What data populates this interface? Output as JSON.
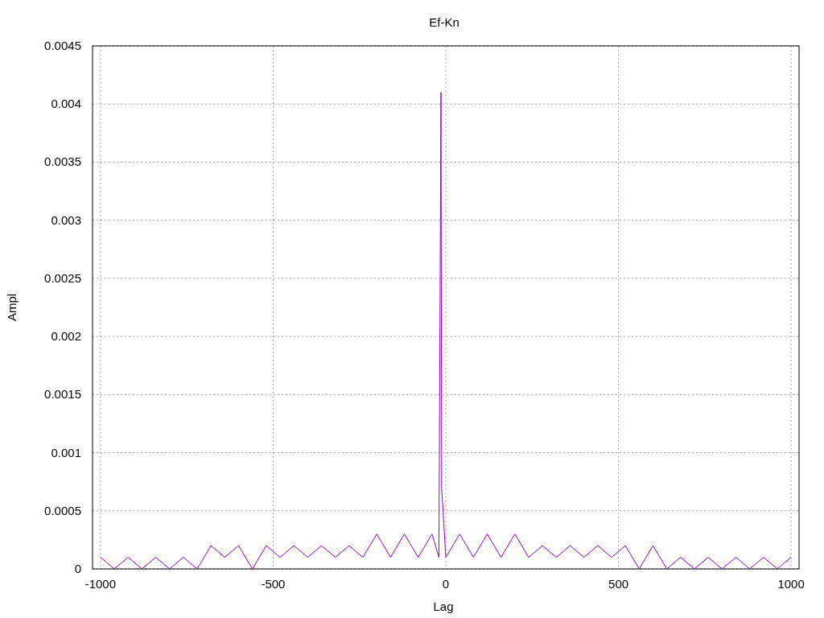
{
  "chart_data": {
    "type": "line",
    "title": "Ef-Kn",
    "xlabel": "Lag",
    "ylabel": "Ampl",
    "grid": true,
    "xlim": [
      -1023,
      1023
    ],
    "ylim": [
      0,
      0.0045
    ],
    "xticks": [
      {
        "value": -1000,
        "label": "-1000"
      },
      {
        "value": -500,
        "label": "-500"
      },
      {
        "value": 0,
        "label": "0"
      },
      {
        "value": 500,
        "label": "500"
      },
      {
        "value": 1000,
        "label": "1000"
      }
    ],
    "yticks": [
      {
        "value": 0,
        "label": "0"
      },
      {
        "value": 0.0005,
        "label": "0.0005"
      },
      {
        "value": 0.001,
        "label": "0.001"
      },
      {
        "value": 0.0015,
        "label": "0.0015"
      },
      {
        "value": 0.002,
        "label": "0.002"
      },
      {
        "value": 0.0025,
        "label": "0.0025"
      },
      {
        "value": 0.003,
        "label": "0.003"
      },
      {
        "value": 0.0035,
        "label": "0.0035"
      },
      {
        "value": 0.004,
        "label": "0.004"
      },
      {
        "value": 0.0045,
        "label": "0.0045"
      }
    ],
    "x": [
      -1000,
      -960,
      -920,
      -880,
      -840,
      -800,
      -760,
      -720,
      -680,
      -640,
      -600,
      -560,
      -520,
      -480,
      -440,
      -400,
      -360,
      -320,
      -280,
      -240,
      -200,
      -160,
      -120,
      -80,
      -40,
      -20,
      -16,
      -14,
      -12,
      -8,
      0,
      40,
      80,
      120,
      160,
      200,
      240,
      280,
      320,
      360,
      400,
      440,
      480,
      520,
      560,
      600,
      640,
      680,
      720,
      760,
      800,
      840,
      880,
      920,
      960,
      1000
    ],
    "series": [
      {
        "color": "#9400d3",
        "values": [
          0.0001,
          0,
          0.0001,
          0,
          0.0001,
          0,
          0.0001,
          0,
          0.0002,
          0.0001,
          0.0002,
          0,
          0.0002,
          0.0001,
          0.0002,
          0.0001,
          0.0002,
          0.0001,
          0.0002,
          0.0001,
          0.0003,
          0.0001,
          0.0003,
          0.0001,
          0.0003,
          0.0001,
          0.0027,
          0.0041,
          0.0007,
          0.0005,
          0.0001,
          0.0003,
          0.0001,
          0.0003,
          0.0001,
          0.0003,
          0.0001,
          0.0002,
          0.0001,
          0.0002,
          0.0001,
          0.0002,
          0.0001,
          0.0002,
          0,
          0.0002,
          0,
          0.0001,
          0,
          0.0001,
          0,
          0.0001,
          0,
          0.0001,
          0,
          0.0001
        ]
      }
    ]
  }
}
